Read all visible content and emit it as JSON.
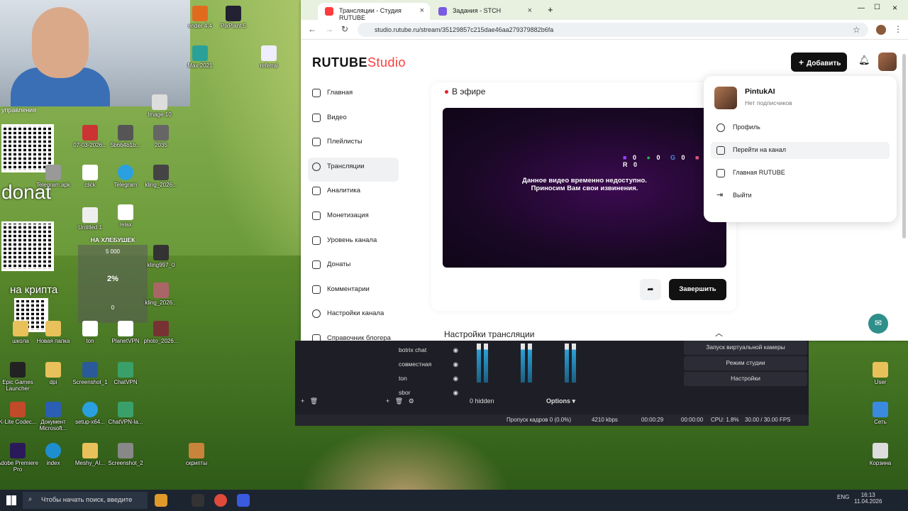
{
  "desktop": {
    "overlays": {
      "donat": "donat",
      "kripta": "на крипта",
      "upravleniya": "управления"
    },
    "widget": {
      "title": "НА ХЛЕБУШЕК",
      "top_value": "5 000",
      "percent": "2%",
      "bottom_value": "0"
    },
    "icons": [
      {
        "label": "ender 4.4"
      },
      {
        "label": "PixPlant 5"
      },
      {
        "label": "Max 2021"
      },
      {
        "label": "referral"
      },
      {
        "label": "Image 10"
      },
      {
        "label": "07-03-2026..."
      },
      {
        "label": "5b6b4b1b..."
      },
      {
        "label": "2035"
      },
      {
        "label": "Telegram.apk"
      },
      {
        "label": "click"
      },
      {
        "label": "Telegram"
      },
      {
        "label": "kling_2026..."
      },
      {
        "label": "Untitled 1"
      },
      {
        "label": "relax"
      },
      {
        "label": "kling997_0"
      },
      {
        "label": "kling_2026..."
      },
      {
        "label": "школа"
      },
      {
        "label": "Новая папка"
      },
      {
        "label": "ton"
      },
      {
        "label": "PlanetVPN"
      },
      {
        "label": "photo_2026..."
      },
      {
        "label": "Epic Games Launcher"
      },
      {
        "label": "dpi"
      },
      {
        "label": "Screenshot_1"
      },
      {
        "label": "ChatVPN"
      },
      {
        "label": "K-Lite Codec..."
      },
      {
        "label": "Документ Microsoft..."
      },
      {
        "label": "setup-x64..."
      },
      {
        "label": "ChatVPN-la..."
      },
      {
        "label": "Adobe Premiere Pro"
      },
      {
        "label": "index"
      },
      {
        "label": "Meshy_AI..."
      },
      {
        "label": "Screenshot_2"
      },
      {
        "label": "скрипты"
      },
      {
        "label": "User"
      },
      {
        "label": "Сеть"
      },
      {
        "label": "Корзина"
      }
    ]
  },
  "browser": {
    "tabs": [
      {
        "label": "Трансляции - Студия RUTUBE",
        "active": true
      },
      {
        "label": "Задания - STCH",
        "active": false
      }
    ],
    "url": "studio.rutube.ru/stream/35129857c215dae46aa279379882b6fa"
  },
  "studio": {
    "logo_main": "RUTUBE",
    "logo_studio": "Studio",
    "add_button": "Добавить",
    "sidebar": [
      {
        "label": "Главная"
      },
      {
        "label": "Видео"
      },
      {
        "label": "Плейлисты"
      },
      {
        "label": "Трансляции",
        "active": true
      },
      {
        "label": "Аналитика"
      },
      {
        "label": "Монетизация"
      },
      {
        "label": "Уровень канала"
      },
      {
        "label": "Донаты"
      },
      {
        "label": "Комментарии"
      },
      {
        "label": "Настройки канала"
      },
      {
        "label": "Справочник блогера"
      }
    ],
    "live_label": "В эфире",
    "video_message_line1": "Данное видео временно недоступно.",
    "video_message_line2": "Приносим Вам свои извинения.",
    "stats": {
      "twitch": "0",
      "youtube": "0",
      "google": "0",
      "vk": "0",
      "rutube": "0"
    },
    "end_button": "Завершить",
    "settings_title": "Настройки трансляции",
    "account_menu": {
      "name": "PintukAI",
      "subtitle": "Нет подписчиков",
      "items": [
        {
          "label": "Профиль"
        },
        {
          "label": "Перейти на канал"
        },
        {
          "label": "Главная RUTUBE"
        },
        {
          "label": "Выйти"
        }
      ]
    }
  },
  "obs": {
    "sources": [
      {
        "label": "botrix chat"
      },
      {
        "label": "совместная"
      },
      {
        "label": "ton"
      },
      {
        "label": "sbor"
      }
    ],
    "hidden": "0 hidden",
    "options": "Options",
    "buttons": [
      {
        "label": "Запуск виртуальной камеры"
      },
      {
        "label": "Режим студии"
      },
      {
        "label": "Настройки"
      }
    ],
    "status": {
      "dropped": "Пропуск кадров 0 (0.0%)",
      "bitrate": "4210 kbps",
      "live_time": "00:00:29",
      "rec_time": "00:00:00",
      "cpu": "CPU: 1.8%",
      "fps": "30.00 / 30.00 FPS"
    }
  },
  "taskbar": {
    "search_placeholder": "Чтобы начать поиск, введите",
    "lang": "ENG",
    "time": "16:13",
    "date": "11.04.2026"
  },
  "colors": {
    "rutube_red": "#ff3b3b",
    "live_red": "#e5202e",
    "help_teal": "#2f8f8a",
    "obs_bg": "#1e1f26"
  }
}
